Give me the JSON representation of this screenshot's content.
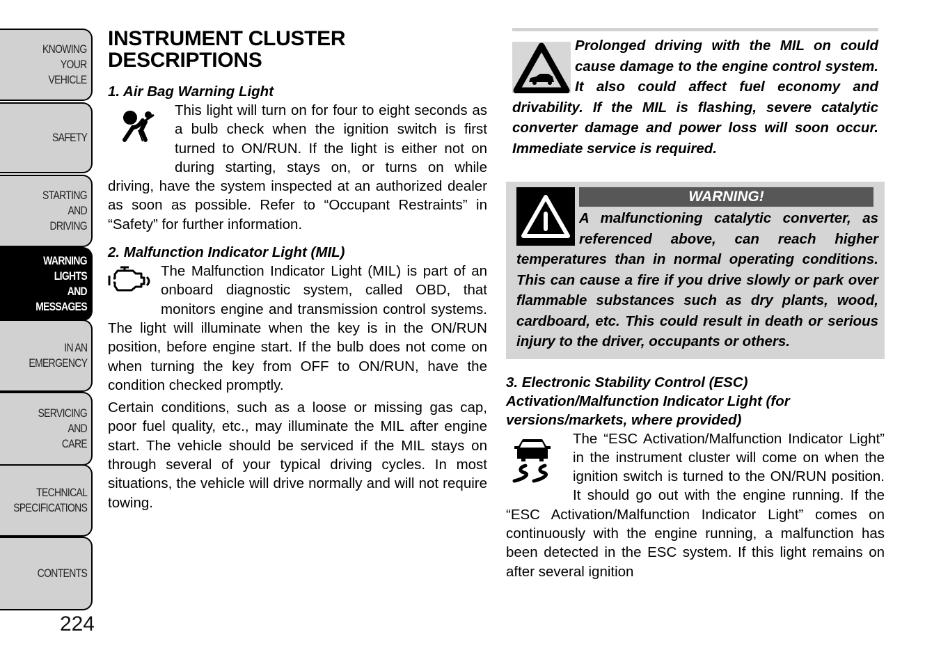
{
  "sidebar": {
    "tabs": [
      {
        "label": "KNOWING\nYOUR\nVEHICLE",
        "active": false
      },
      {
        "label": "SAFETY",
        "active": false
      },
      {
        "label": "STARTING\nAND\nDRIVING",
        "active": false
      },
      {
        "label": "WARNING\nLIGHTS\nAND\nMESSAGES",
        "active": true
      },
      {
        "label": "IN AN\nEMERGENCY",
        "active": false
      },
      {
        "label": "SERVICING\nAND\nCARE",
        "active": false
      },
      {
        "label": "TECHNICAL\nSPECIFICATIONS",
        "active": false
      },
      {
        "label": "CONTENTS",
        "active": false
      }
    ],
    "page_number": "224"
  },
  "left": {
    "title": "INSTRUMENT CLUSTER DESCRIPTIONS",
    "section1": {
      "heading": "1.  Air Bag Warning Light",
      "icon": "airbag-warning-icon",
      "text": "This light will turn on for four to eight seconds as a bulb check when the ignition switch is first turned to ON/RUN. If the light is either not on during starting, stays on, or turns on while driving, have the system inspected at an authorized dealer as soon as possible. Refer to “Occupant Restraints” in “Safety” for further information."
    },
    "section2": {
      "heading": "2.  Malfunction Indicator Light (MIL)",
      "icon": "check-engine-icon",
      "text1": "The Malfunction Indicator Light (MIL) is part of an onboard diagnostic system, called OBD, that monitors engine and transmission control systems. The light will illuminate when the key is in the ON/RUN position, before engine start. If the bulb does not come on when turning the key from OFF to ON/RUN, have the condition checked promptly.",
      "text2": "Certain conditions, such as a loose or missing gas cap, poor fuel quality, etc., may illuminate the MIL after engine start. The vehicle should be serviced if the MIL stays on through several of your typical driving cycles. In most situations, the vehicle will drive normally and will not require towing."
    }
  },
  "right": {
    "caution": {
      "icon": "vehicle-caution-triangle-icon",
      "text": "Prolonged driving with the MIL on could cause damage to the engine control system. It also could affect fuel economy and drivability. If the MIL is flashing, severe catalytic converter damage and power loss will soon occur. Immediate service is required."
    },
    "warning": {
      "icon": "warning-triangle-icon",
      "label": "WARNING!",
      "text": "A malfunctioning catalytic converter, as referenced above, can reach higher temperatures than in normal operating conditions. This can cause a fire if you drive slowly or park over flammable substances such as dry plants, wood, cardboard, etc. This could result in death or serious injury to the driver, occupants or others."
    },
    "section3": {
      "heading": "3.  Electronic Stability Control (ESC) Activation/Malfunction Indicator Light (for versions/markets, where provided)",
      "icon": "esc-skid-icon",
      "text": "The “ESC Activation/Malfunction Indicator Light” in the instrument cluster will come on when the ignition switch is turned to the ON/RUN position. It should go out with the engine running. If the “ESC Activation/Malfunction Indicator Light” comes on continuously with the engine running, a malfunction has been detected in the ESC system. If this light remains on after several ignition"
    }
  }
}
